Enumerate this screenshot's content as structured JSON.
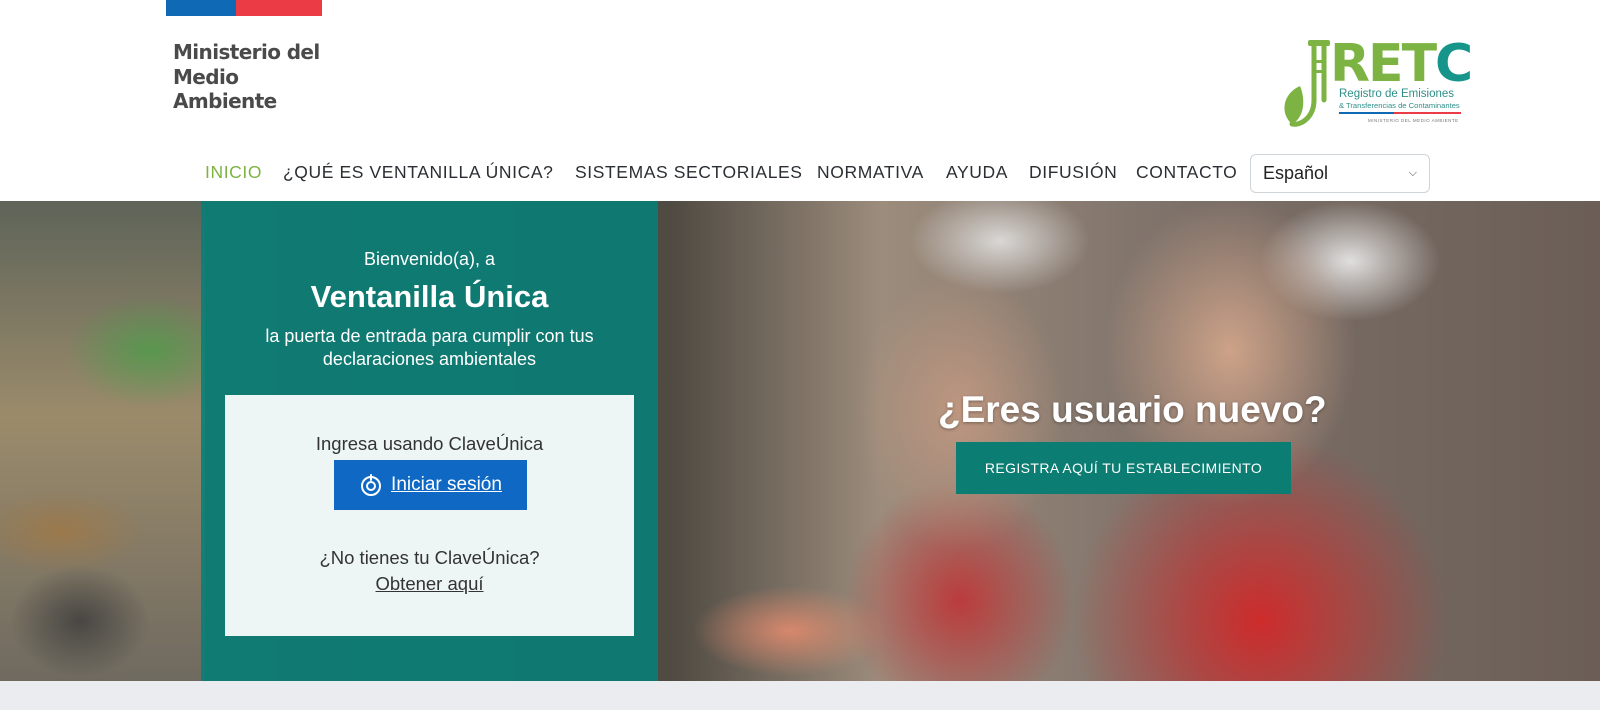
{
  "header": {
    "ministry_lines": [
      "Ministerio del",
      "Medio",
      "Ambiente"
    ],
    "retc_logo": {
      "letters_green": "R",
      "letters_mid": "ET",
      "letters_teal": "C",
      "line1": "Registro de Emisiones",
      "line2": "& Transferencias de Contaminantes",
      "line3": "MINISTERIO DEL MEDIO AMBIENTE"
    }
  },
  "nav": {
    "items": [
      {
        "label": "INICIO",
        "active": true
      },
      {
        "label": "¿QUÉ ES VENTANILLA ÚNICA?",
        "active": false
      },
      {
        "label": "SISTEMAS SECTORIALES",
        "active": false
      },
      {
        "label": "NORMATIVA",
        "active": false
      },
      {
        "label": "AYUDA",
        "active": false
      },
      {
        "label": "DIFUSIÓN",
        "active": false
      },
      {
        "label": "CONTACTO",
        "active": false
      }
    ],
    "language_selected": "Español"
  },
  "hero": {
    "greeting": "Bienvenido(a), a",
    "title": "Ventanilla Única",
    "description": "la puerta de entrada para cumplir con tus declaraciones ambientales",
    "login": {
      "prompt": "Ingresa usando ClaveÚnica",
      "button_label": "Iniciar sesión",
      "no_account": "¿No tienes tu ClaveÚnica?",
      "get_link": "Obtener aquí"
    },
    "new_user_title": "¿Eres usuario nuevo?",
    "register_button": "REGISTRA AQUÍ TU ESTABLECIMIENTO"
  },
  "colors": {
    "gov_blue": "#0f69b4",
    "gov_red": "#eb3c46",
    "accent_green": "#7cb342",
    "panel_teal": "#068078",
    "login_blue": "#0f69c4",
    "register_teal": "#0b7d73"
  }
}
